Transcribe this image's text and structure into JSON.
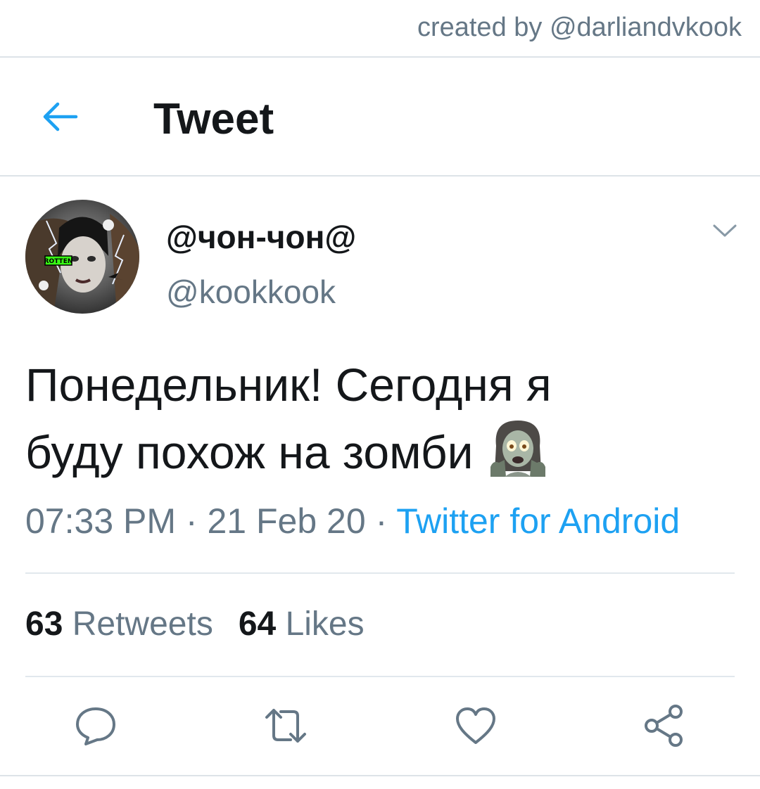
{
  "credit": "created by @darliandvkook",
  "header": {
    "title": "Tweet",
    "back_icon": "arrow-left-icon"
  },
  "tweet": {
    "display_name": "@чон-чон@",
    "handle": "@kookkook",
    "avatar_badge": "ROTTEN",
    "text_line1": "Понедельник! Сегодня я",
    "text_line2": "буду похож на зомби",
    "emoji": "zombie-emoji",
    "time": "07:33 PM",
    "date": "21 Feb 20",
    "separator": "·",
    "source": "Twitter for Android"
  },
  "stats": {
    "retweets_count": "63",
    "retweets_label": "Retweets",
    "likes_count": "64",
    "likes_label": "Likes"
  },
  "actions": [
    "reply-icon",
    "retweet-icon",
    "like-icon",
    "share-icon"
  ],
  "colors": {
    "accent": "#1da1f2",
    "muted": "#657786",
    "text": "#14171a",
    "divider": "#e1e8ed"
  }
}
